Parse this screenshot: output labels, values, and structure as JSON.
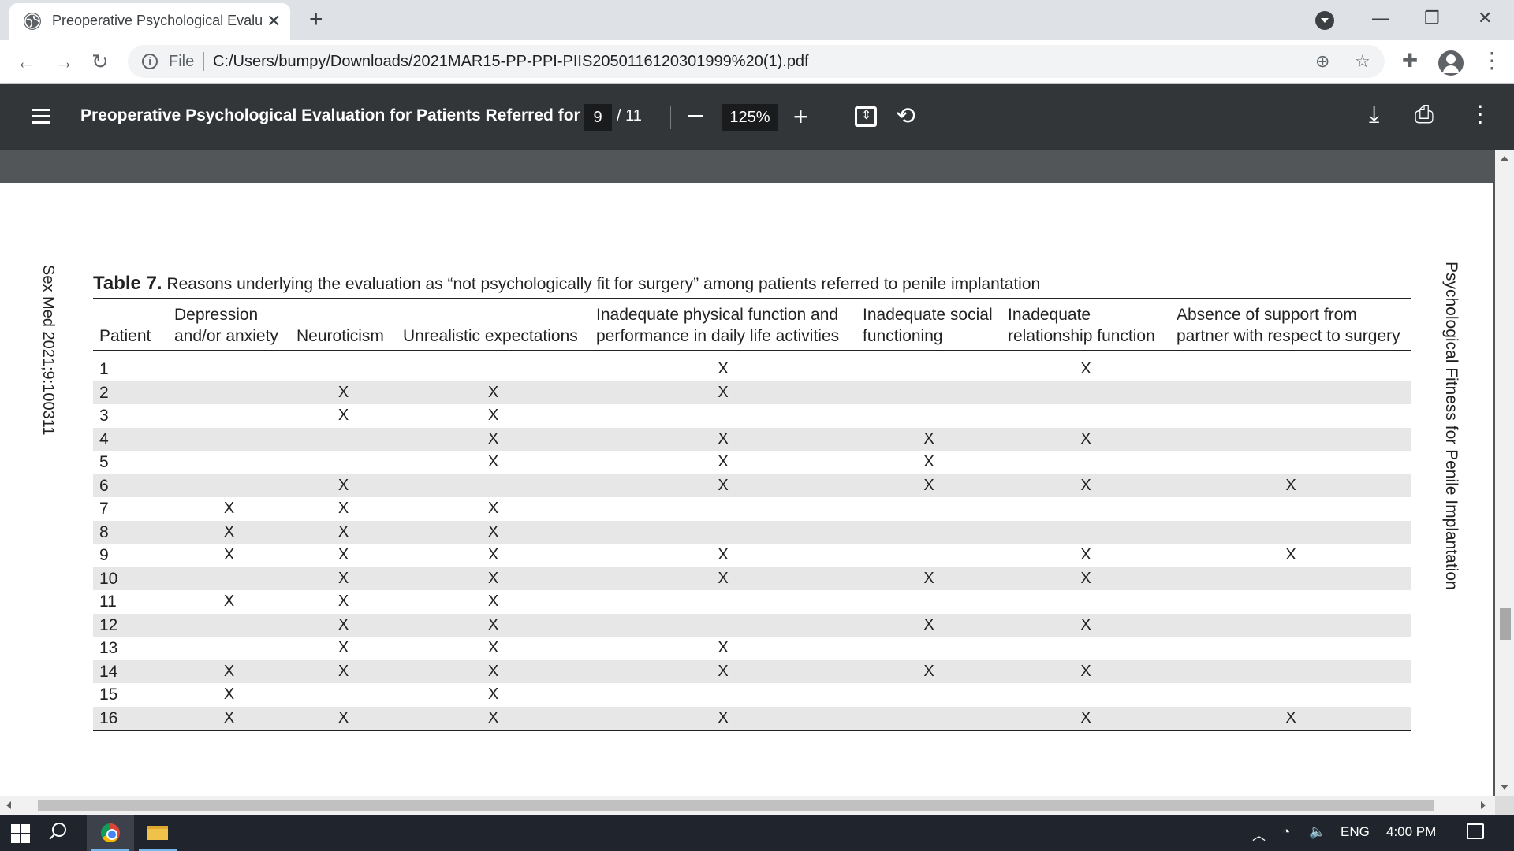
{
  "browser": {
    "tab_title": "Preoperative Psychological Evalu",
    "file_label": "File",
    "url": "C:/Users/bumpy/Downloads/2021MAR15-PP-PPI-PIIS2050116120301999%20(1).pdf"
  },
  "pdf_toolbar": {
    "title": "Preoperative Psychological Evaluation for Patients Referred for ...",
    "current_page": "9",
    "total_pages": "/ 11",
    "zoom": "125%"
  },
  "page": {
    "side_left": "Sex Med 2021;9:100311",
    "side_right": "Psychological Fitness for Penile Implantation",
    "caption_label": "Table 7.",
    "caption_text": " Reasons underlying the evaluation as “not psychologically fit for surgery” among patients referred to penile implantation"
  },
  "table": {
    "headers": [
      "Patient",
      "Depression and/or anxiety",
      "Neuroticism",
      "Unrealistic expectations",
      "Inadequate physical function and performance in daily life activities",
      "Inadequate social functioning",
      "Inadequate relationship function",
      "Absence of support from partner with respect to surgery"
    ],
    "rows": [
      [
        "1",
        "",
        "",
        "",
        "X",
        "",
        "X",
        ""
      ],
      [
        "2",
        "",
        "X",
        "X",
        "X",
        "",
        "",
        ""
      ],
      [
        "3",
        "",
        "X",
        "X",
        "",
        "",
        "",
        ""
      ],
      [
        "4",
        "",
        "",
        "X",
        "X",
        "X",
        "X",
        ""
      ],
      [
        "5",
        "",
        "",
        "X",
        "X",
        "X",
        "",
        ""
      ],
      [
        "6",
        "",
        "X",
        "",
        "X",
        "X",
        "X",
        "X"
      ],
      [
        "7",
        "X",
        "X",
        "X",
        "",
        "",
        "",
        ""
      ],
      [
        "8",
        "X",
        "X",
        "X",
        "",
        "",
        "",
        ""
      ],
      [
        "9",
        "X",
        "X",
        "X",
        "X",
        "",
        "X",
        "X"
      ],
      [
        "10",
        "",
        "X",
        "X",
        "X",
        "X",
        "X",
        ""
      ],
      [
        "11",
        "X",
        "X",
        "X",
        "",
        "",
        "",
        ""
      ],
      [
        "12",
        "",
        "X",
        "X",
        "",
        "X",
        "X",
        ""
      ],
      [
        "13",
        "",
        "X",
        "X",
        "X",
        "",
        "",
        ""
      ],
      [
        "14",
        "X",
        "X",
        "X",
        "X",
        "X",
        "X",
        ""
      ],
      [
        "15",
        "X",
        "",
        "X",
        "",
        "",
        "",
        ""
      ],
      [
        "16",
        "X",
        "X",
        "X",
        "X",
        "",
        "X",
        "X"
      ]
    ]
  },
  "taskbar": {
    "language": "ENG",
    "time": "4:00 PM"
  },
  "colors": {
    "pdf_toolbar_bg": "#323639",
    "viewer_bg": "#525659",
    "row_stripe": "#e7e7e7",
    "taskbar_bg": "#20242c"
  }
}
